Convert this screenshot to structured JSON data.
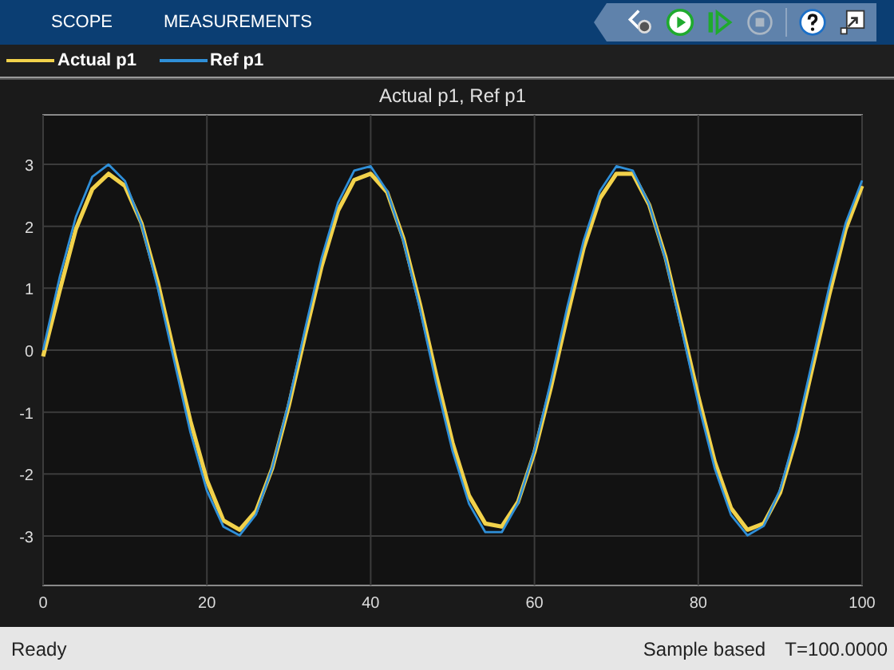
{
  "toolstrip": {
    "tabs": [
      {
        "label": "SCOPE",
        "selected": false
      },
      {
        "label": "MEASUREMENTS",
        "selected": false
      }
    ]
  },
  "chart": {
    "chart_data": {
      "type": "line",
      "title": "Actual p1, Ref p1",
      "x": [
        0,
        2,
        4,
        6,
        8,
        10,
        12,
        14,
        16,
        18,
        20,
        22,
        24,
        26,
        28,
        30,
        32,
        34,
        36,
        38,
        40,
        42,
        44,
        46,
        48,
        50,
        52,
        54,
        56,
        58,
        60,
        62,
        64,
        66,
        68,
        70,
        72,
        74,
        76,
        78,
        80,
        82,
        84,
        86,
        88,
        90,
        92,
        94,
        96,
        98,
        100
      ],
      "series": [
        {
          "name": "Actual p1",
          "color": "#f2d24b",
          "values": [
            -0.1,
            0.95,
            1.95,
            2.6,
            2.85,
            2.65,
            2.05,
            1.1,
            -0.05,
            -1.15,
            -2.1,
            -2.75,
            -2.9,
            -2.6,
            -1.9,
            -0.9,
            0.25,
            1.35,
            2.25,
            2.75,
            2.85,
            2.55,
            1.8,
            0.75,
            -0.4,
            -1.5,
            -2.35,
            -2.8,
            -2.85,
            -2.45,
            -1.65,
            -0.6,
            0.55,
            1.65,
            2.45,
            2.85,
            2.85,
            2.35,
            1.5,
            0.4,
            -0.75,
            -1.8,
            -2.55,
            -2.9,
            -2.8,
            -2.3,
            -1.4,
            -0.25,
            0.9,
            1.95,
            2.65
          ]
        },
        {
          "name": "Ref p1",
          "color": "#2f8fd8",
          "values": [
            0,
            1.17,
            2.15,
            2.8,
            3,
            2.73,
            2.03,
            1.01,
            -0.17,
            -1.33,
            -2.27,
            -2.85,
            -2.99,
            -2.65,
            -1.89,
            -0.84,
            0.35,
            1.48,
            2.38,
            2.9,
            2.97,
            2.57,
            1.76,
            0.67,
            -0.53,
            -1.63,
            -2.48,
            -2.94,
            -2.94,
            -2.47,
            -1.61,
            -0.5,
            0.69,
            1.77,
            2.57,
            2.97,
            2.9,
            2.36,
            1.46,
            0.32,
            -0.86,
            -1.91,
            -2.66,
            -2.99,
            -2.84,
            -2.25,
            -1.3,
            -0.14,
            1.03,
            2.05,
            2.74
          ]
        }
      ],
      "xlim": [
        0,
        100
      ],
      "ylim": [
        -3.8,
        3.8
      ],
      "xticks": [
        0,
        20,
        40,
        60,
        80,
        100
      ],
      "yticks": [
        -3,
        -2,
        -1,
        0,
        1,
        2,
        3
      ],
      "grid": true
    }
  },
  "status_bar": {
    "state": "Ready",
    "mode": "Sample based",
    "time": "T=100.0000"
  }
}
